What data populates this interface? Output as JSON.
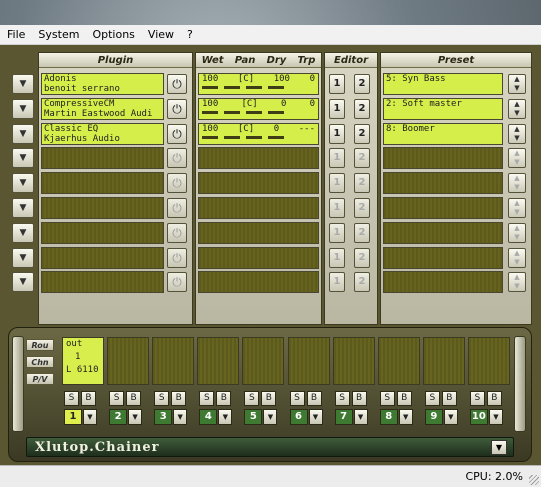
{
  "menu": [
    "File",
    "System",
    "Options",
    "View",
    "?"
  ],
  "headers": {
    "plugin": "Plugin",
    "wet": "Wet",
    "pan": "Pan",
    "dry": "Dry",
    "trp": "Trp",
    "editor": "Editor",
    "preset": "Preset"
  },
  "rows": [
    {
      "name": "Adonis",
      "author": "benoit serrano",
      "wet": "100",
      "pan": "[C]",
      "dry": "100",
      "trp": "0",
      "preset": "5: Syn Bass"
    },
    {
      "name": "CompressiveCM",
      "author": "Martin Eastwood Audi",
      "wet": "100",
      "pan": "[C]",
      "dry": "0",
      "trp": "0",
      "preset": "2: Soft master"
    },
    {
      "name": "Classic EQ",
      "author": "Kjaerhus Audio",
      "wet": "100",
      "pan": "[C]",
      "dry": "0",
      "trp": "---",
      "preset": "8: Boomer"
    }
  ],
  "empty_rows": 6,
  "editor_buttons": [
    "1",
    "2"
  ],
  "row_button_glyph": "▼",
  "power_glyph": "⏻",
  "route": {
    "labels": {
      "rou": "Rou",
      "chn": "Chn",
      "pv": "P/V"
    },
    "out": {
      "target": "out",
      "channel": "1",
      "pv": "L 6110"
    },
    "channels": [
      "1",
      "2",
      "3",
      "4",
      "5",
      "6",
      "7",
      "8",
      "9",
      "10"
    ],
    "route_buttons": [
      "S",
      "B"
    ]
  },
  "logo": "Xlutop.Chainer",
  "status": {
    "cpu": "CPU: 2.0%"
  }
}
